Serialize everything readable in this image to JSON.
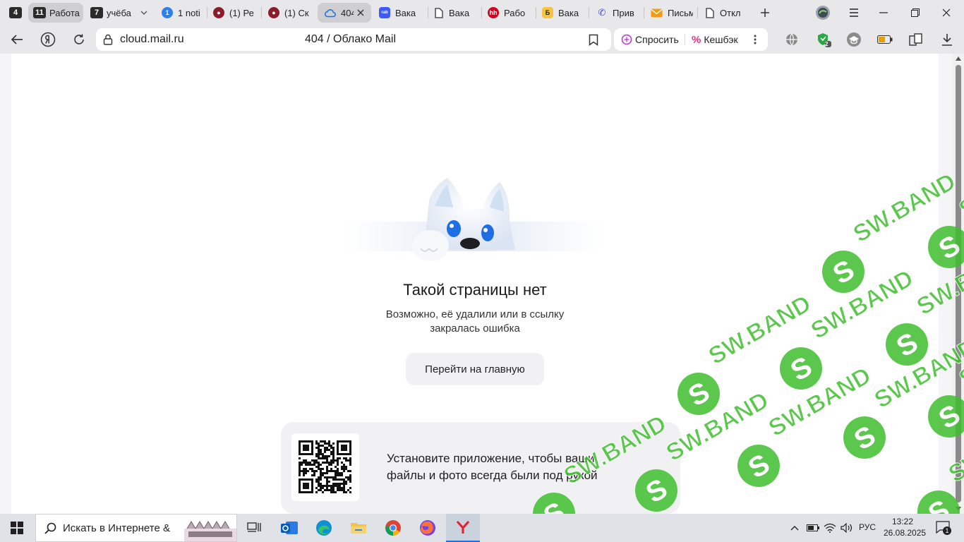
{
  "tabs": {
    "group_counts": [
      {
        "count": "4",
        "label": ""
      },
      {
        "count": "11",
        "label": "Работа"
      },
      {
        "count": "7",
        "label": "учёба"
      }
    ],
    "items": [
      {
        "favicon_text": "1",
        "favicon_color": "#2f80ed",
        "label": "1 noti"
      },
      {
        "favicon_text": "",
        "favicon_color": "#8a1c2b",
        "label": "(1) Ре"
      },
      {
        "favicon_text": "",
        "favicon_color": "#8a1c2b",
        "label": "(1) Ск"
      },
      {
        "favicon_text": "",
        "favicon_color": "#1a73e8",
        "label": "404"
      },
      {
        "favicon_text": "rabota",
        "favicon_color": "#3d5afe",
        "label": "Вака"
      },
      {
        "favicon_text": "",
        "favicon_color": "#ffffff",
        "label": "Вака"
      },
      {
        "favicon_text": "hh",
        "favicon_color": "#d6001c",
        "label": "Рабо"
      },
      {
        "favicon_text": "Б",
        "favicon_color": "#f5c542",
        "label": "Вака"
      },
      {
        "favicon_text": "",
        "favicon_color": "#4a4ae0",
        "label": "Прив"
      },
      {
        "favicon_text": "",
        "favicon_color": "#f39c12",
        "label": "Письм"
      },
      {
        "favicon_text": "",
        "favicon_color": "#ffffff",
        "label": "Откл"
      }
    ]
  },
  "address_bar": {
    "url": "cloud.mail.ru",
    "page_title": "404 / Облако Mail",
    "ask_label": "Спросить",
    "cashback_label": "Кешбэк",
    "extension_badge": "2"
  },
  "page": {
    "error_title": "Такой страницы нет",
    "error_desc_line1": "Возможно, её удалили или в ссылку",
    "error_desc_line2": "закралась ошибка",
    "home_button": "Перейти на главную",
    "promo_line1": "Установите приложение, чтобы ваши",
    "promo_line2": "файлы и фото всегда были под рукой",
    "watermark_text": "SW.BAND"
  },
  "taskbar": {
    "search_placeholder": "Искать в Интернете &",
    "language": "РУС",
    "time": "13:22",
    "date": "26.08.2025",
    "notification_count": "1"
  },
  "colors": {
    "accent_blue": "#1a73e8",
    "watermark_green": "#3fbf2f",
    "cashback_pink": "#e0338a"
  }
}
